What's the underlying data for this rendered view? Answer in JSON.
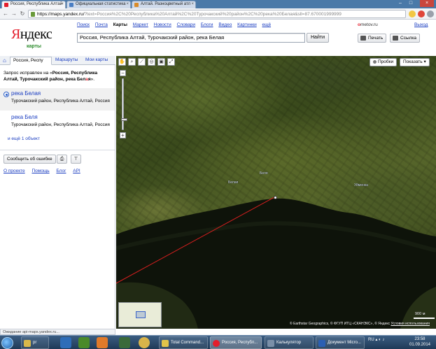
{
  "browser": {
    "tabs": [
      {
        "title": "Россия, Республика Алтай",
        "icon_color": "#e41e2c"
      },
      {
        "title": "Официальная статистика",
        "icon_color": "#4a7ec4"
      },
      {
        "title": "Алтай. Разноцветный атл",
        "icon_color": "#d98c2a"
      }
    ],
    "url_host": "https://maps.yandex.ru/",
    "url_path": "?text=Россия%2C%20Республика%20Алтай%2C%20Турочакский%20район%2C%20река%20Белая&sll=87.670001999999"
  },
  "yandex": {
    "nav": [
      "Поиск",
      "Почта",
      "Карты",
      "Маркет",
      "Новости",
      "Словари",
      "Блоги",
      "Видео",
      "Картинки",
      "ещё"
    ],
    "nav_current": "Карты",
    "logo_ya": "Я",
    "logo_rest": "ндекс",
    "logo_sub": "карты",
    "search_value": "Россия, Республика Алтай, Турочакский район, река Белая",
    "find_label": "Найти",
    "brand_highlight": "o",
    "brand_rest": "metov.ru",
    "exit_label": "Выход",
    "print_label": "Печать",
    "link_label": "Ссылка"
  },
  "leftpanel": {
    "tabs": [
      "Россия, Респу",
      "Маршруты",
      "Мои карты"
    ],
    "correction_prefix": "Запрос исправлен на «",
    "correction_bold": "Россия, Республика Алтай, Турочакский район, река Бел",
    "correction_highlight": "а",
    "correction_bold_end": "я",
    "correction_suffix": "».",
    "results": [
      {
        "title": "река Белая",
        "subtitle": "Турочакский район, Республика Алтай, Россия"
      },
      {
        "title": "река Беля",
        "subtitle": "Турочакский район, Республика Алтай, Россия"
      }
    ],
    "more_results": "и ещё 1 объект",
    "report_error": "Сообщить об ошибке",
    "footer": [
      "О проекте",
      "Помощь",
      "Блог",
      "API"
    ],
    "status": "Ожидание api-maps.yandex.ru..."
  },
  "map": {
    "traffic_label": "Пробки",
    "show_label": "Показать",
    "scale_label": "900 м",
    "copyright_text": "© Earthstar Geographics, © ФГУП ИТЦ «СКАНЭКС», © Яндекс",
    "terms_label": "Условия использования",
    "labels": [
      "Белая",
      "Беля",
      "Уйменка"
    ],
    "zoom_level_fraction": 0.82
  },
  "taskbar": {
    "items": [
      {
        "label": "pr",
        "icon_color": "#d8b84a"
      },
      {
        "label": "Total Command...",
        "icon_color": "#e0c34a"
      },
      {
        "label": "Россия, Республ...",
        "icon_color": "#e41e2c"
      },
      {
        "label": "Калькулятор",
        "icon_color": "#7a8fa8"
      },
      {
        "label": "Документ Micro...",
        "icon_color": "#2b5fb3"
      }
    ],
    "lang": "RU",
    "time": "23:58",
    "date": "01.09.2014"
  }
}
